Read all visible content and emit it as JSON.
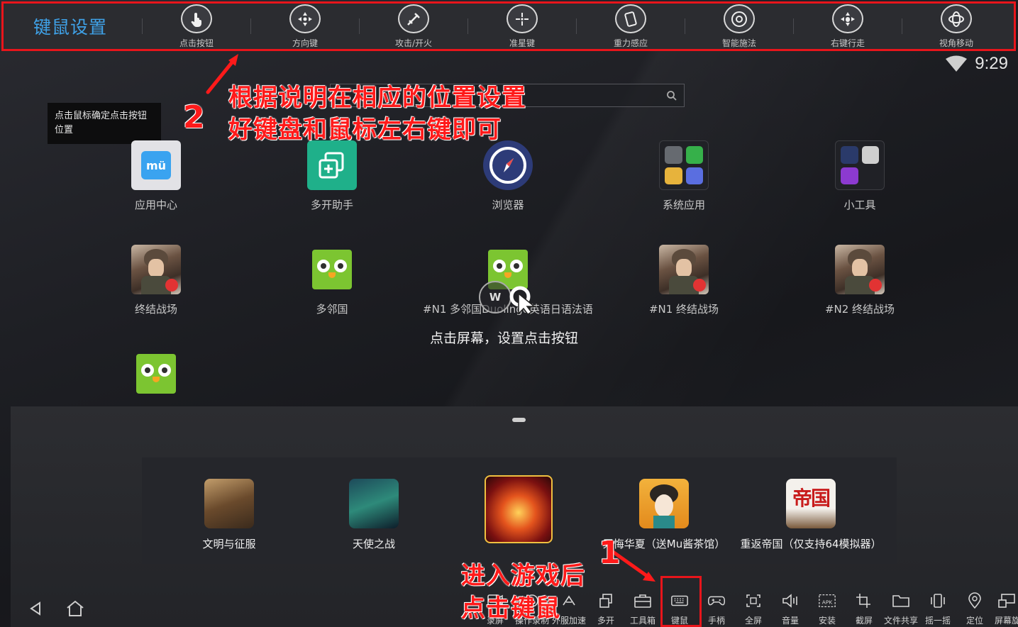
{
  "keymap_toolbar": {
    "title": "键鼠设置",
    "tools": [
      {
        "label": "点击按钮",
        "icon": "hand-tap-icon"
      },
      {
        "label": "方向键",
        "icon": "dpad-icon"
      },
      {
        "label": "攻击/开火",
        "icon": "attack-icon"
      },
      {
        "label": "准星键",
        "icon": "crosshair-icon"
      },
      {
        "label": "重力感应",
        "icon": "gravity-icon"
      },
      {
        "label": "智能施法",
        "icon": "smart-cast-icon"
      },
      {
        "label": "右键行走",
        "icon": "right-click-walk-icon"
      },
      {
        "label": "视角移动",
        "icon": "view-move-icon"
      }
    ]
  },
  "status": {
    "time": "9:29"
  },
  "tooltip": {
    "text": "点击鼠标确定点击按钮位置"
  },
  "annotations": {
    "step2_number": "2",
    "step2_line1": "根据说明在相应的位置设置",
    "step2_line2": "好键盘和鼠标左右键即可",
    "step1_number": "1",
    "step1_line1": "进入游戏后",
    "step1_line2": "点击键鼠"
  },
  "apps": [
    {
      "label": "应用中心"
    },
    {
      "label": "多开助手"
    },
    {
      "label": "浏览器"
    },
    {
      "label": "系统应用"
    },
    {
      "label": "小工具"
    },
    {
      "label": "终结战场"
    },
    {
      "label": "多邻国"
    },
    {
      "label": "#N1 多邻国Duolingo英语日语法语"
    },
    {
      "label": "#N1 终结战场"
    },
    {
      "label": "#N2 终结战场"
    }
  ],
  "hint": {
    "circle_letter": "W",
    "text": "点击屏幕，设置点击按钮"
  },
  "recommended": [
    {
      "label": "文明与征服"
    },
    {
      "label": "天使之战"
    },
    {
      "label": ""
    },
    {
      "label": "无悔华夏（送Mu酱茶馆）"
    },
    {
      "label": "重返帝国（仅支持64模拟器）"
    }
  ],
  "empire_icon_text": "帝国",
  "bottom_toolbar": [
    {
      "label": "录屏",
      "icon": "record-screen-icon"
    },
    {
      "label": "操作录制",
      "icon": "macro-record-icon"
    },
    {
      "label": "外服加速",
      "icon": "accelerate-icon"
    },
    {
      "label": "多开",
      "icon": "multi-instance-icon"
    },
    {
      "label": "工具箱",
      "icon": "toolbox-icon"
    },
    {
      "label": "键鼠",
      "icon": "keyboard-icon"
    },
    {
      "label": "手柄",
      "icon": "gamepad-icon"
    },
    {
      "label": "全屏",
      "icon": "fullscreen-icon"
    },
    {
      "label": "音量",
      "icon": "volume-icon"
    },
    {
      "label": "安装",
      "icon": "install-apk-icon"
    },
    {
      "label": "截屏",
      "icon": "crop-icon"
    },
    {
      "label": "文件共享",
      "icon": "folder-icon"
    },
    {
      "label": "摇一摇",
      "icon": "shake-icon"
    },
    {
      "label": "定位",
      "icon": "location-icon"
    },
    {
      "label": "屏幕旋",
      "icon": "rotate-screen-icon"
    }
  ],
  "colors": {
    "highlight_red": "#e8151b",
    "title_blue": "#3fa2e8"
  }
}
